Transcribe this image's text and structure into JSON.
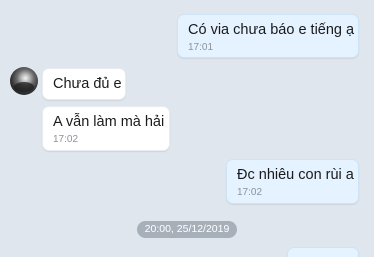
{
  "messages": [
    {
      "direction": "outgoing",
      "text": "Có via chưa báo e tiếng ạ",
      "time": "17:01"
    },
    {
      "direction": "incoming",
      "text": "Chưa đủ e",
      "time": ""
    },
    {
      "direction": "incoming",
      "text": "A vẫn làm mà hải",
      "time": "17:02"
    },
    {
      "direction": "outgoing",
      "text": "Đc nhiêu con rùi a",
      "time": "17:02"
    }
  ],
  "date_separator": "20:00, 25/12/2019"
}
